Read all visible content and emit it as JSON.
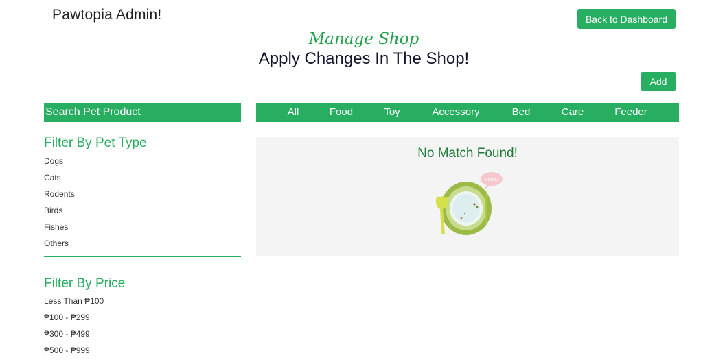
{
  "header": {
    "brand": "Pawtopia Admin!",
    "back_label": "Back to Dashboard",
    "subtitle": "Manage Shop",
    "title": "Apply Changes In The Shop!",
    "add_label": "Add"
  },
  "search": {
    "placeholder": "Search Pet Product"
  },
  "filters": {
    "pet_type_title": "Filter By Pet Type",
    "pet_types": [
      "Dogs",
      "Cats",
      "Rodents",
      "Birds",
      "Fishes",
      "Others"
    ],
    "price_title": "Filter By Price",
    "prices": [
      "Less Than ₱100",
      "₱100 - ₱299",
      "₱300 - ₱499",
      "₱500 - ₱999"
    ]
  },
  "tabs": [
    "All",
    "Food",
    "Toy",
    "Accessory",
    "Bed",
    "Care",
    "Feeder"
  ],
  "results": {
    "empty_message": "No Match Found!",
    "bubble_text": "Food?"
  },
  "colors": {
    "accent": "#27ae60",
    "title": "#13132e",
    "panel": "#f4f4f4"
  }
}
